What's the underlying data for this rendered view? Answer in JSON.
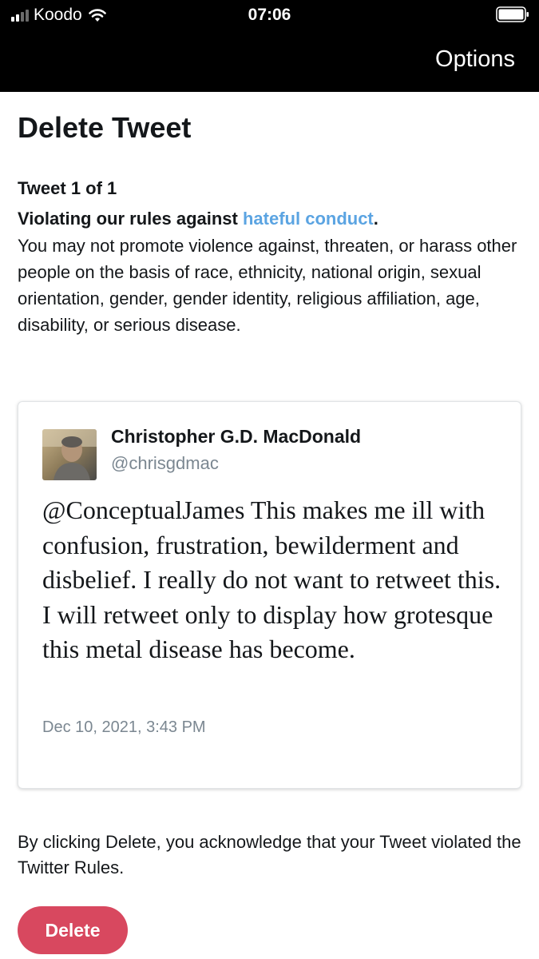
{
  "status_bar": {
    "carrier": "Koodo",
    "time": "07:06",
    "icons": [
      "signal-icon",
      "wifi-icon",
      "battery-icon"
    ]
  },
  "nav": {
    "options_label": "Options"
  },
  "page": {
    "title": "Delete Tweet",
    "tweet_count": "Tweet 1 of 1",
    "violation_prefix": "Violating our rules against ",
    "violation_link": "hateful conduct",
    "violation_suffix": ".",
    "violation_description": "You may not promote violence against, threaten, or harass other people on the basis of race, ethnicity, national origin, sexual orientation, gender, gender identity, religious affiliation, age, disability, or serious disease."
  },
  "tweet": {
    "author_name": "Christopher G.D. MacDonald",
    "author_handle": "@chrisgdmac",
    "text": "@ConceptualJames This makes me ill with confusion, frustration, bewilderment and disbelief. I really do not want to retweet this. I will retweet only to display how grotesque this metal disease has become.",
    "date": "Dec 10, 2021, 3:43 PM"
  },
  "footer": {
    "acknowledgement": "By clicking Delete, you acknowledge that your Tweet violated the Twitter Rules.",
    "delete_label": "Delete"
  },
  "colors": {
    "link": "#5ba4e2",
    "delete_button": "#d8485f",
    "secondary_text": "#7b8791",
    "top_bar": "#000000"
  }
}
